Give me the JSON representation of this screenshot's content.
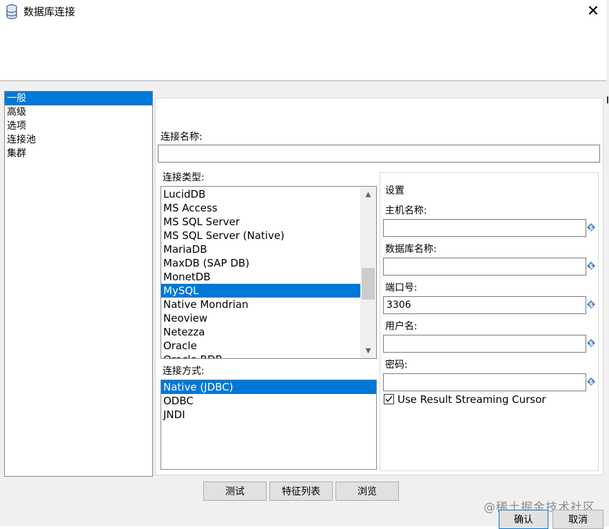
{
  "window": {
    "title": "数据库连接",
    "close_glyph": "✕"
  },
  "nav": {
    "items": [
      {
        "label": "一般",
        "selected": true
      },
      {
        "label": "高级",
        "selected": false
      },
      {
        "label": "选项",
        "selected": false
      },
      {
        "label": "连接池",
        "selected": false
      },
      {
        "label": "集群",
        "selected": false
      }
    ]
  },
  "general": {
    "connection_name_label": "连接名称:",
    "connection_name_value": "",
    "connection_type_label": "连接类型:",
    "connection_types": [
      "LucidDB",
      "MS Access",
      "MS SQL Server",
      "MS SQL Server (Native)",
      "MariaDB",
      "MaxDB (SAP DB)",
      "MonetDB",
      "MySQL",
      "Native Mondrian",
      "Neoview",
      "Netezza",
      "Oracle",
      "Oracle RDB"
    ],
    "selected_type": "MySQL",
    "access_label": "连接方式:",
    "access_methods": [
      "Native (JDBC)",
      "ODBC",
      "JNDI"
    ],
    "selected_access": "Native (JDBC)"
  },
  "settings": {
    "title": "设置",
    "host_label": "主机名称:",
    "host_value": "",
    "db_label": "数据库名称:",
    "db_value": "",
    "port_label": "端口号:",
    "port_value": "3306",
    "user_label": "用户名:",
    "user_value": "",
    "password_label": "密码:",
    "password_value": "",
    "streaming_cursor_label": "Use Result Streaming Cursor",
    "streaming_cursor_checked": true,
    "variable_icon": "dollar-variable-icon"
  },
  "buttons": {
    "test": "测试",
    "features": "特征列表",
    "explore": "浏览",
    "ok": "确认",
    "cancel": "取消"
  },
  "watermark": "@稀土掘金技术社区",
  "colors": {
    "selection": "#0078d7",
    "dialog_bg": "#f0f0f0",
    "button_bg": "#e1e1e1"
  }
}
